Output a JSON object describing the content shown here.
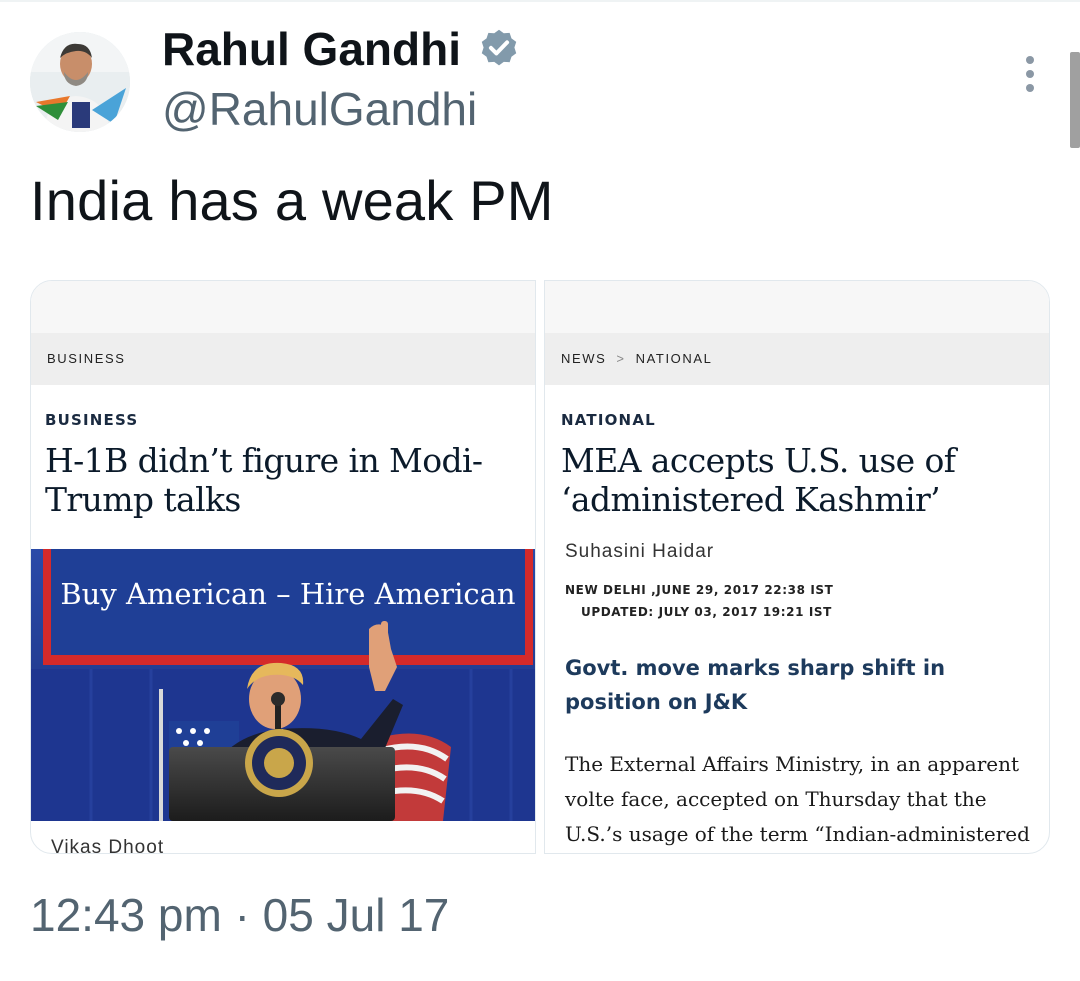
{
  "tweet": {
    "author_name": "Rahul Gandhi",
    "handle": "@RahulGandhi",
    "text": "India has a weak PM",
    "timestamp": "12:43 pm · 05 Jul 17",
    "verified_icon": "verified-badge-icon",
    "more_icon": "more-options-icon"
  },
  "card_left": {
    "breadcrumb": "BUSINESS",
    "section": "BUSINESS",
    "headline_line1": "H-1B didn’t figure in Modi-",
    "headline_line2": "Trump talks",
    "banner_text": "Buy American – Hire American",
    "byline": "Vikas Dhoot"
  },
  "card_right": {
    "breadcrumb_1": "NEWS",
    "breadcrumb_sep": ">",
    "breadcrumb_2": "NATIONAL",
    "section": "NATIONAL",
    "headline_line1": "MEA accepts U.S. use of",
    "headline_line2": "‘administered Kashmir’",
    "author": "Suhasini Haidar",
    "dateline": "NEW DELHI ,JUNE 29, 2017 22:38 IST",
    "updated": "UPDATED: JULY 03, 2017 19:21 IST",
    "subhead": "Govt. move marks sharp shift in position on J&K",
    "body_line1": "The External Affairs Ministry, in an apparent",
    "body_line2": "volte face, accepted on Thursday that the",
    "body_line3": "U.S.’s usage of the term “Indian-administered"
  },
  "colors": {
    "text_primary": "#0f1419",
    "text_secondary": "#536471",
    "verified": "#829aab",
    "banner_blue": "#1f3f96",
    "banner_red": "#d42a2a"
  }
}
